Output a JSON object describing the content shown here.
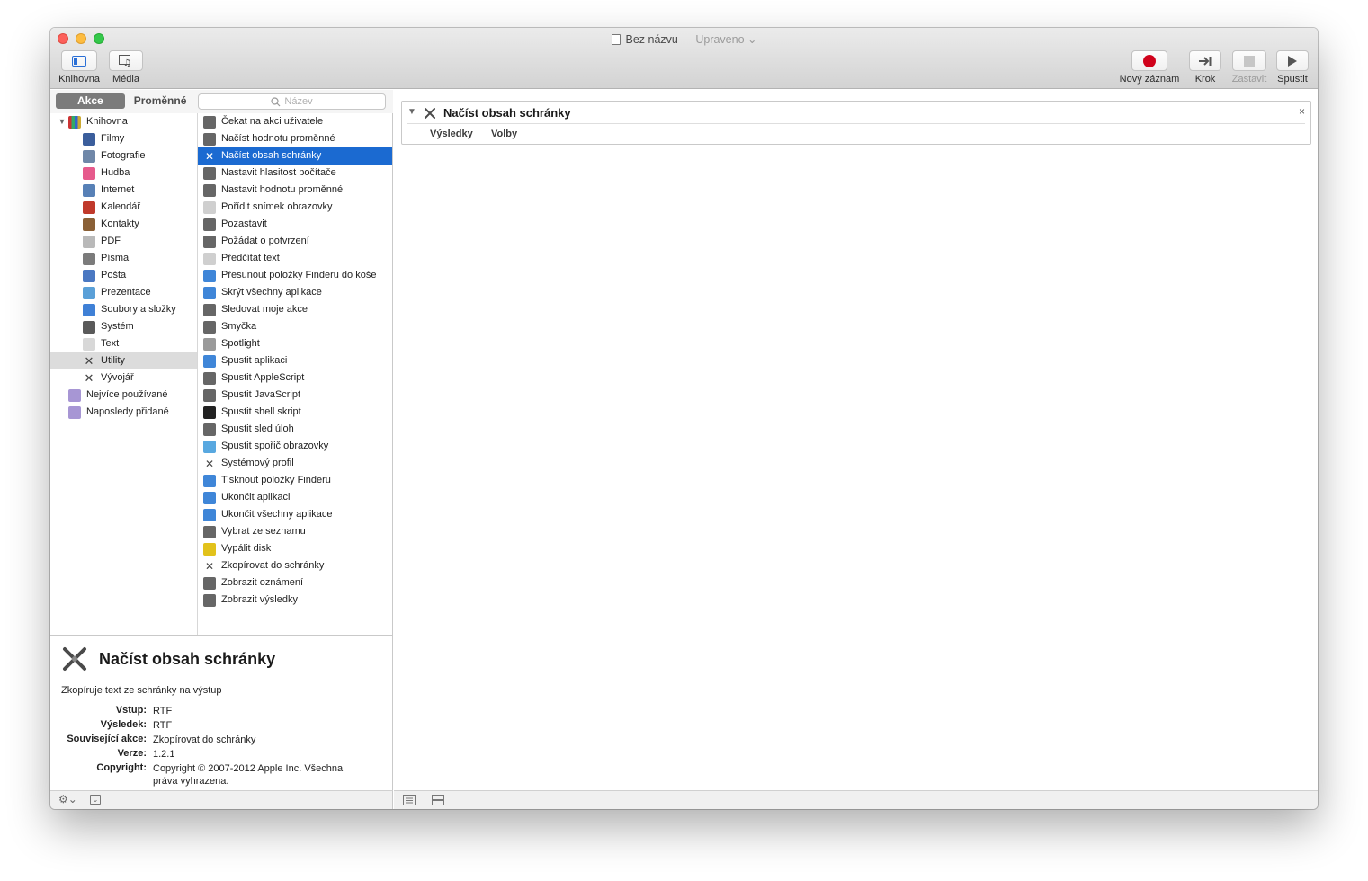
{
  "window": {
    "title": "Bez názvu",
    "status": "Upraveno"
  },
  "toolbar": {
    "left": [
      {
        "label": "Knihovna",
        "icon": "library-icon"
      },
      {
        "label": "Média",
        "icon": "media-icon"
      }
    ],
    "right": [
      {
        "label": "Nový záznam",
        "icon": "record-icon"
      },
      {
        "label": "Krok",
        "icon": "step-icon"
      },
      {
        "label": "Zastavit",
        "icon": "stop-icon"
      },
      {
        "label": "Spustit",
        "icon": "play-icon"
      }
    ]
  },
  "tabs": {
    "actions": "Akce",
    "variables": "Proměnné"
  },
  "search": {
    "placeholder": "Název"
  },
  "library": {
    "root": "Knihovna",
    "items": [
      "Filmy",
      "Fotografie",
      "Hudba",
      "Internet",
      "Kalendář",
      "Kontakty",
      "PDF",
      "Písma",
      "Pošta",
      "Prezentace",
      "Soubory a složky",
      "Systém",
      "Text",
      "Utility",
      "Vývojář"
    ],
    "selected": "Utility",
    "smart": [
      "Nejvíce používané",
      "Naposledy přidané"
    ]
  },
  "actions": {
    "items": [
      "Čekat na akci uživatele",
      "Načíst hodnotu proměnné",
      "Načíst obsah schránky",
      "Nastavit hlasitost počítače",
      "Nastavit hodnotu proměnné",
      "Pořídit snímek obrazovky",
      "Pozastavit",
      "Požádat o potvrzení",
      "Předčítat text",
      "Přesunout položky Finderu do koše",
      "Skrýt všechny aplikace",
      "Sledovat moje akce",
      "Smyčka",
      "Spotlight",
      "Spustit aplikaci",
      "Spustit AppleScript",
      "Spustit JavaScript",
      "Spustit shell skript",
      "Spustit sled úloh",
      "Spustit spořič obrazovky",
      "Systémový profil",
      "Tisknout položky Finderu",
      "Ukončit aplikaci",
      "Ukončit všechny aplikace",
      "Vybrat ze seznamu",
      "Vypálit disk",
      "Zkopírovat do schránky",
      "Zobrazit oznámení",
      "Zobrazit výsledky"
    ],
    "selected": "Načíst obsah schránky"
  },
  "description": {
    "title": "Načíst obsah schránky",
    "summary": "Zkopíruje text ze schránky na výstup",
    "fields": [
      {
        "key": "Vstup:",
        "value": "RTF"
      },
      {
        "key": "Výsledek:",
        "value": "RTF"
      },
      {
        "key": "Související akce:",
        "value": "Zkopírovat do schránky"
      },
      {
        "key": "Verze:",
        "value": "1.2.1"
      },
      {
        "key": "Copyright:",
        "value": "Copyright © 2007-2012 Apple Inc. Všechna práva vyhrazena."
      }
    ]
  },
  "workflow": {
    "card": {
      "title": "Načíst obsah schránky",
      "close": "×",
      "tabs": [
        "Výsledky",
        "Volby"
      ]
    }
  },
  "colors": {
    "selection": "#1b6ad1",
    "record": "#d0021b"
  }
}
